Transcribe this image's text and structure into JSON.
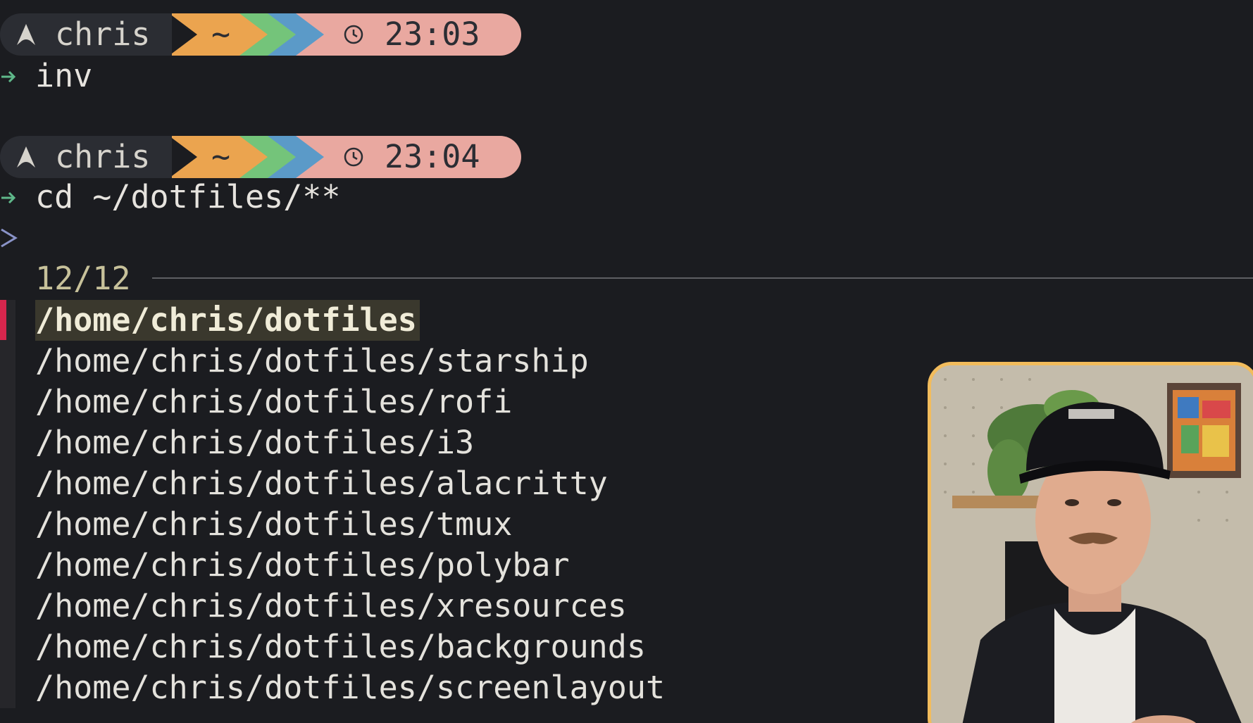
{
  "prompts": [
    {
      "user": "chris",
      "dir": "~",
      "time": "23:03",
      "command": "inv"
    },
    {
      "user": "chris",
      "dir": "~",
      "time": "23:04",
      "command": "cd ~/dotfiles/**"
    }
  ],
  "fzf": {
    "prompt_symbol": ">",
    "counter": "12/12",
    "results": [
      "/home/chris/dotfiles",
      "/home/chris/dotfiles/starship",
      "/home/chris/dotfiles/rofi",
      "/home/chris/dotfiles/i3",
      "/home/chris/dotfiles/alacritty",
      "/home/chris/dotfiles/tmux",
      "/home/chris/dotfiles/polybar",
      "/home/chris/dotfiles/xresources",
      "/home/chris/dotfiles/backgrounds",
      "/home/chris/dotfiles/screenlayout"
    ],
    "selected_index": 0
  },
  "icons": {
    "os": "arch-logo-icon",
    "clock": "clock-icon",
    "command_arrow": "right-arrow-icon",
    "fzf_prompt": "chevron-right-icon"
  },
  "colors": {
    "background": "#1b1c20",
    "user_segment": "#2b2d33",
    "dir_segment": "#eba44f",
    "green_segment": "#74c47a",
    "blue_segment": "#5b9ac8",
    "time_segment": "#e9a8a0",
    "selection_marker": "#d7264d",
    "webcam_border": "#f2bc5c"
  }
}
